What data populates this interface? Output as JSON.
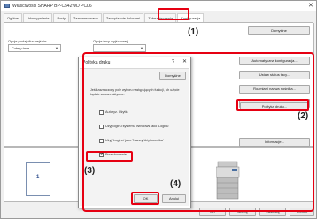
{
  "window": {
    "title": "Właściwości SHARP BP-C542WD PCL6",
    "close_glyph": "✕"
  },
  "tabs": [
    {
      "label": "Ogólne"
    },
    {
      "label": "Udostępnianie"
    },
    {
      "label": "Porty"
    },
    {
      "label": "Zaawansowane"
    },
    {
      "label": "Zarządzanie kolorami"
    },
    {
      "label": "Zabezpieczenia"
    },
    {
      "label": "Konfiguracja"
    }
  ],
  "config": {
    "options_label": "Opcje podajnika wejścia:",
    "options_value": "Cztery tace",
    "output_label": "Opcje tacy wyjściowej:",
    "output_value": "",
    "default_button": "Domyślne",
    "auto_config_button": "Automatyczna konfiguracja...",
    "tray_status_button": "Ustaw status tacy...",
    "paper_size_button": "Rozmiar i nazwa nośnika...",
    "document_filing_button": "Ustaw Dokumentowanie Tandem",
    "policy_button": "Polityka druku...",
    "info_button": "Informacje..."
  },
  "preview": {
    "page_number": "1"
  },
  "bottom_buttons": {
    "ok": "OK",
    "cancel": "Anuluj",
    "apply": "Zastosuj",
    "help": "Pomoc"
  },
  "dialog": {
    "title": "Polityka druku",
    "help_glyph": "?",
    "close_glyph": "✕",
    "default_button": "Domyślne",
    "description": "Jeśli zaznaczony pole wyboru następujących funkcji, ich użycie będzie zawsze aktywne.",
    "options": [
      {
        "label": "Autoryz. Użytk.",
        "checked": false
      },
      {
        "label": "Użyj loginu systemu Windows jako 'Loginu'",
        "checked": false
      },
      {
        "label": "Użyj 'Loginu' jako 'Nazwy Użytkownika'",
        "checked": false
      },
      {
        "label": "Przechowanie",
        "checked": true
      }
    ],
    "ok_button": "OK",
    "cancel_button": "Anuluj"
  },
  "callouts": {
    "c1": "(1)",
    "c2": "(2)",
    "c3": "(3)",
    "c4": "(4)"
  },
  "colors": {
    "highlight": "#e60012"
  }
}
